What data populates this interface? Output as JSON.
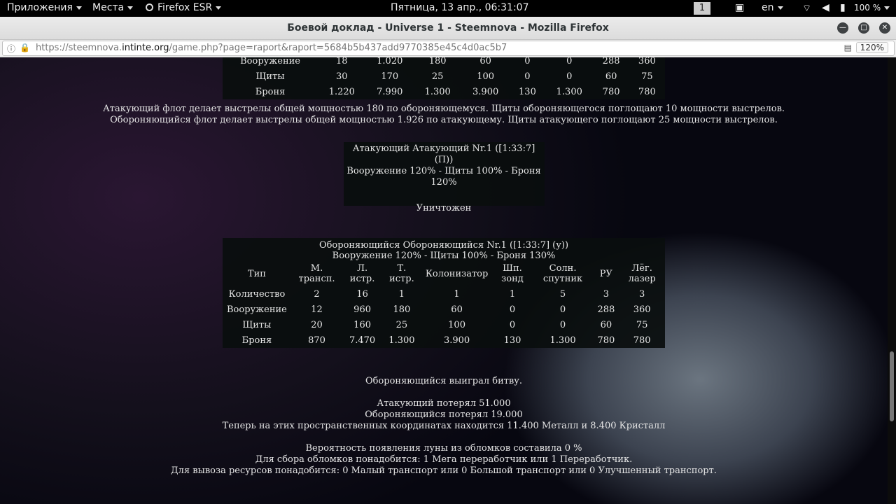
{
  "topbar": {
    "apps": "Приложения",
    "places": "Места",
    "browser": "Firefox ESR",
    "clock": "Пятница, 13 апр., 06:31:07",
    "workspace": "1",
    "lang": "en",
    "battery": "100 %"
  },
  "window": {
    "title": "Боевой доклад - Universe 1 - Steemnova - Mozilla Firefox",
    "url_pre": "https://steemnova.",
    "url_domain": "intinte.org",
    "url_post": "/game.php?page=raport&raport=5684b5b437add9770385e45c4d0ac5b7",
    "zoom": "120%"
  },
  "partial_table": {
    "rows": [
      {
        "label": "Вооружение",
        "values": [
          "18",
          "1.020",
          "180",
          "60",
          "0",
          "0",
          "288",
          "360"
        ]
      },
      {
        "label": "Щиты",
        "values": [
          "30",
          "170",
          "25",
          "100",
          "0",
          "0",
          "60",
          "75"
        ]
      },
      {
        "label": "Броня",
        "values": [
          "1.220",
          "7.990",
          "1.300",
          "3.900",
          "130",
          "1.300",
          "780",
          "780"
        ]
      }
    ]
  },
  "round_msgs": [
    "Атакующий флот делает выстрелы общей мощностью 180 по обороняющемуся. Щиты обороняющегося поглощают 10 мощности выстрелов.",
    "Обороняющийся флот делает выстрелы общей мощностью 1.926 по атакующему. Щиты атакующего поглощают 25 мощности выстрелов."
  ],
  "attacker": {
    "title": "Атакующий Атакующий Nr.1 ([1:33:7] (П))",
    "tech": "Вооружение 120% - Щиты 100% - Броня 120%",
    "status": "Уничтожен"
  },
  "defender": {
    "title": "Обороняющийся Обороняющийся Nr.1 ([1:33:7] (у))",
    "tech": "Вооружение 120% - Щиты 100% - Броня 130%",
    "headers": [
      "Тип",
      "М. трансп.",
      "Л. истр.",
      "Т. истр.",
      "Колонизатор",
      "Шп. зонд",
      "Солн. спутник",
      "РУ",
      "Лёг. лазер"
    ],
    "rows": [
      {
        "label": "Количество",
        "values": [
          "2",
          "16",
          "1",
          "1",
          "1",
          "5",
          "3",
          "3"
        ]
      },
      {
        "label": "Вооружение",
        "values": [
          "12",
          "960",
          "180",
          "60",
          "0",
          "0",
          "288",
          "360"
        ]
      },
      {
        "label": "Щиты",
        "values": [
          "20",
          "160",
          "25",
          "100",
          "0",
          "0",
          "60",
          "75"
        ]
      },
      {
        "label": "Броня",
        "values": [
          "870",
          "7.470",
          "1.300",
          "3.900",
          "130",
          "1.300",
          "780",
          "780"
        ]
      }
    ]
  },
  "result": {
    "winner": "Обороняющийся выиграл битву.",
    "att_lost": "Атакующий потерял 51.000",
    "def_lost": "Обороняющийся потерял 19.000",
    "debris": "Теперь на этих пространственных координатах находится 11.400 Металл и 8.400 Кристалл",
    "moon": "Вероятность появления луны из обломков составила 0 %",
    "recyclers": "Для сбора обломков понадобится: 1 Мега переработчик или 1 Переработчик.",
    "transports": "Для вывоза ресурсов понадобится: 0 Малый транспорт или 0 Большой транспорт или 0 Улучшенный транспорт."
  }
}
